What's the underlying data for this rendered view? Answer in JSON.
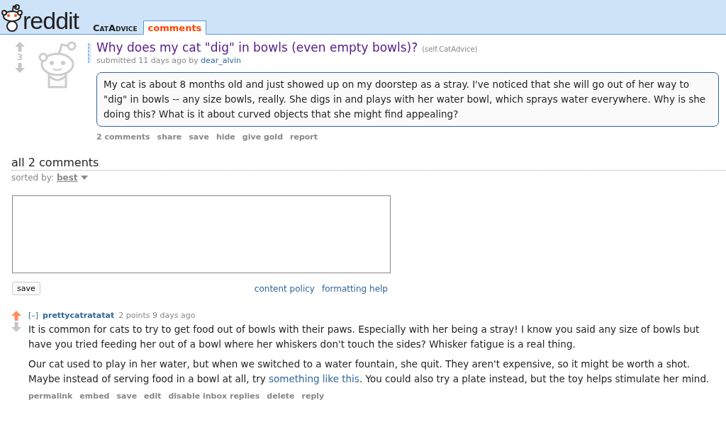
{
  "header": {
    "logo": "reddit",
    "subreddit": "CatAdvice",
    "tabs": [
      {
        "label": "comments",
        "selected": true
      }
    ]
  },
  "post": {
    "score": "3",
    "upvoted": false,
    "title": "Why does my cat \"dig\" in bowls (even empty bowls)?",
    "domain": "(self.CatAdvice)",
    "tagline": "submitted 11 days ago by",
    "author": "dear_alvin",
    "selftext": "My cat is about 8 months old and just showed up on my doorstep as a stray. I've noticed that she will go out of her way to \"dig\" in bowls -- any size bowls, really. She digs in and plays with her water bowl, which sprays water everywhere. Why is she doing this? What is it about curved objects that she might find appealing?",
    "buttons": [
      "2 comments",
      "share",
      "save",
      "hide",
      "give gold",
      "report"
    ]
  },
  "comments_header": {
    "title": "all 2 comments",
    "sorted_label": "sorted by:",
    "sort": "best"
  },
  "reply_form": {
    "save": "save",
    "links": [
      "content policy",
      "formatting help"
    ]
  },
  "comments": [
    {
      "upvoted": true,
      "collapse": "[–]",
      "author": "prettycatratatat",
      "meta": "2 points 9 days ago",
      "paragraphs": [
        {
          "text": "It is common for cats to try to get food out of bowls with their paws. Especially with her being a stray! I know you said any size of bowls but have you tried feeding her out of a bowl where her whiskers don't touch the sides? Whisker fatigue is a real thing."
        },
        {
          "text": "Our cat used to play in her water, but when we switched to a water fountain, she quit. They aren't expensive, so it might be worth a shot. Maybe instead of serving food in a bowl at all, try",
          "link": "something like this",
          "after": ". You could also try a plate instead, but the toy helps stimulate her mind."
        }
      ],
      "buttons": [
        "permalink",
        "embed",
        "save",
        "edit",
        "disable inbox replies",
        "delete",
        "reply"
      ]
    }
  ]
}
